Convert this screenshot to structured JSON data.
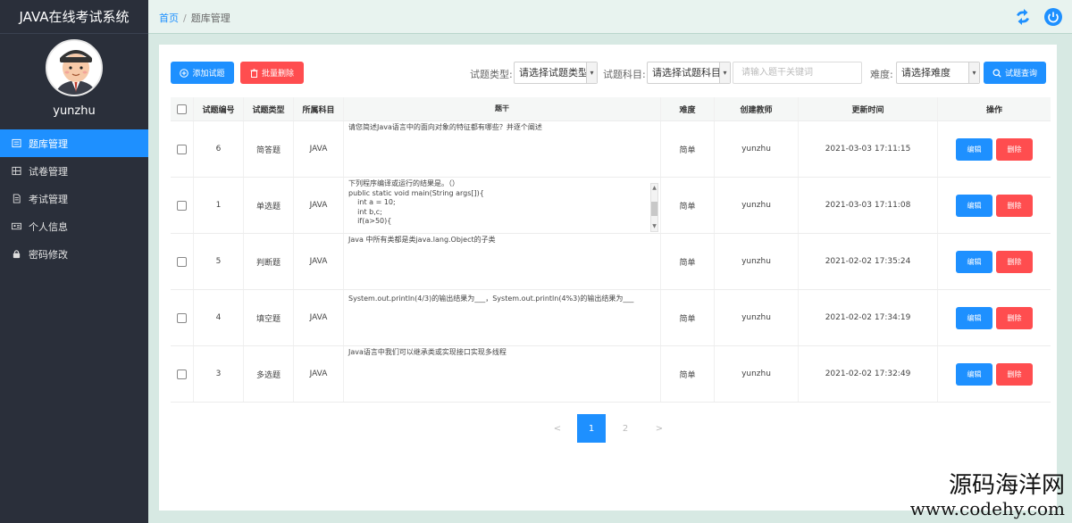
{
  "app": {
    "title": "JAVA在线考试系统",
    "username": "yunzhu"
  },
  "sidebar": {
    "items": [
      {
        "label": "题库管理",
        "icon": "list-icon",
        "active": true
      },
      {
        "label": "试卷管理",
        "icon": "table-icon",
        "active": false
      },
      {
        "label": "考试管理",
        "icon": "document-icon",
        "active": false
      },
      {
        "label": "个人信息",
        "icon": "id-card-icon",
        "active": false
      },
      {
        "label": "密码修改",
        "icon": "lock-icon",
        "active": false
      }
    ]
  },
  "breadcrumb": {
    "home": "首页",
    "separator": "/",
    "current": "题库管理"
  },
  "toolbar": {
    "add_label": "添加试题",
    "batch_delete_label": "批量删除",
    "type_label": "试题类型:",
    "type_value": "请选择试题类型",
    "subject_label": "试题科目:",
    "subject_value": "请选择试题科目",
    "keyword_placeholder": "请输入题干关键词",
    "difficulty_label": "难度:",
    "difficulty_value": "请选择难度",
    "search_label": "试题查询"
  },
  "table": {
    "headers": [
      "试题编号",
      "试题类型",
      "所属科目",
      "题干",
      "难度",
      "创建教师",
      "更新时间",
      "操作"
    ],
    "edit_label": "编辑",
    "delete_label": "删除",
    "rows": [
      {
        "id": "6",
        "type": "简答题",
        "subject": "JAVA",
        "stem": [
          "请您简述Java语言中的面向对象的特征都有哪些？并逐个阐述"
        ],
        "difficulty": "简单",
        "teacher": "yunzhu",
        "updated": "2021-03-03 17:11:15"
      },
      {
        "id": "1",
        "type": "单选题",
        "subject": "JAVA",
        "stem": [
          "下列程序编译或运行的结果是。（）",
          "public static void main(String args[]){",
          "    int a = 10;",
          "    int b,c;",
          "    if(a>50){"
        ],
        "difficulty": "简单",
        "teacher": "yunzhu",
        "updated": "2021-03-03 17:11:08"
      },
      {
        "id": "5",
        "type": "判断题",
        "subject": "JAVA",
        "stem": [
          "Java 中所有类都是类java.lang.Object的子类"
        ],
        "difficulty": "简单",
        "teacher": "yunzhu",
        "updated": "2021-02-02 17:35:24"
      },
      {
        "id": "4",
        "type": "填空题",
        "subject": "JAVA",
        "stem": [
          "System.out.println(4/3)的输出结果为___，System.out.println(4%3)的输出结果为___"
        ],
        "difficulty": "简单",
        "teacher": "yunzhu",
        "updated": "2021-02-02 17:34:19"
      },
      {
        "id": "3",
        "type": "多选题",
        "subject": "JAVA",
        "stem": [
          "Java语言中我们可以继承类或实现接口实现多线程"
        ],
        "difficulty": "简单",
        "teacher": "yunzhu",
        "updated": "2021-02-02 17:32:49"
      }
    ]
  },
  "pager": {
    "prev": "<",
    "pages": [
      "1",
      "2"
    ],
    "current": "1",
    "next": ">"
  },
  "watermark": {
    "line1": "源码海洋网",
    "line2": "www.codehy.com"
  },
  "colors": {
    "primary": "#1e90ff",
    "danger": "#ff4d4f",
    "sidebar": "#2a2f3a",
    "background": "#d7e9e3"
  }
}
